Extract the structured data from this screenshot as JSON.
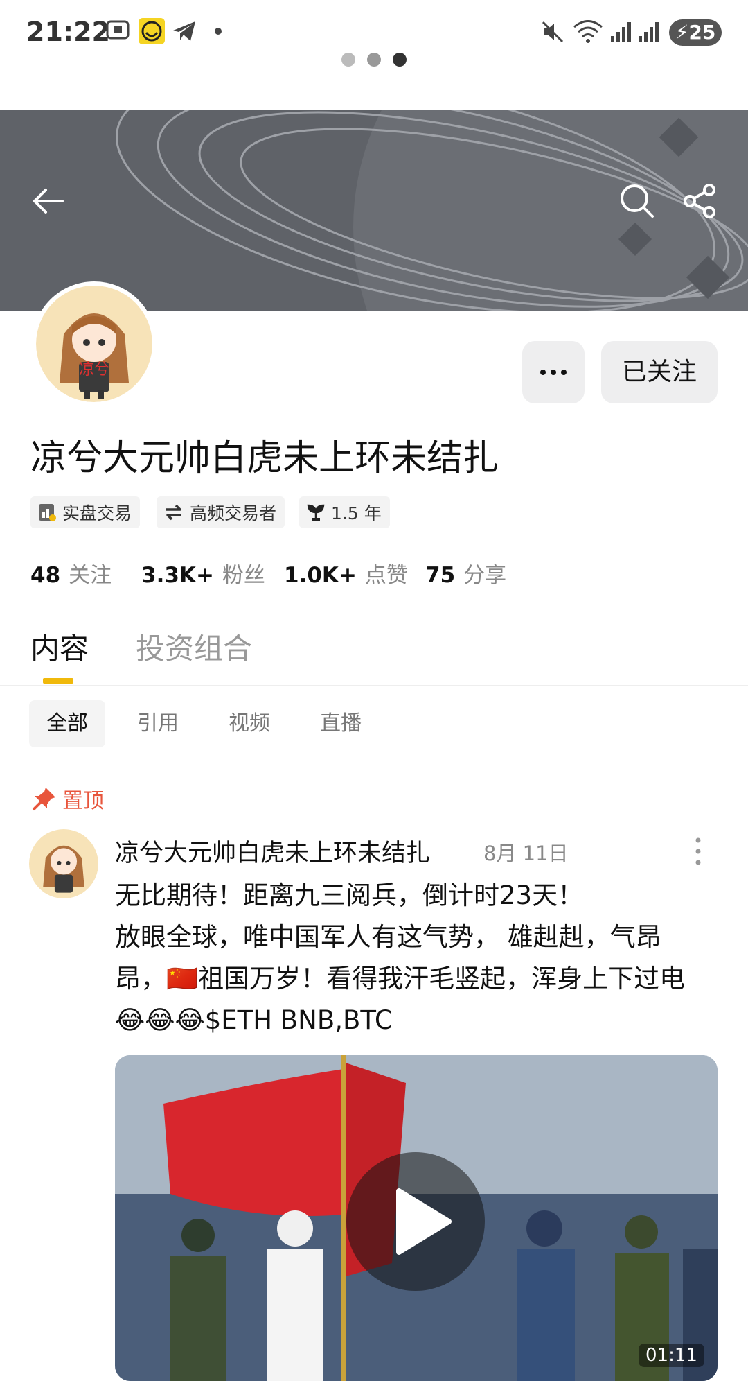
{
  "status_bar": {
    "time": "21:22",
    "battery": "25"
  },
  "header": {
    "back_icon": "arrow-left-icon",
    "search_icon": "search-icon",
    "share_icon": "share-icon"
  },
  "profile": {
    "username": "凉兮大元帅白虎未上环未结扎",
    "avatar_text": "凉兮",
    "more_label": "···",
    "follow_label": "已关注",
    "tags": [
      {
        "label": "实盘交易",
        "icon": "chart-badge-icon"
      },
      {
        "label": "高频交易者",
        "icon": "swap-icon"
      },
      {
        "label": "1.5 年",
        "icon": "sprout-icon"
      }
    ],
    "stats": [
      {
        "value": "48",
        "label": "关注"
      },
      {
        "value": "3.3K+",
        "label": "粉丝"
      },
      {
        "value": "1.0K+",
        "label": "点赞"
      },
      {
        "value": "75",
        "label": "分享"
      }
    ]
  },
  "tabs": [
    {
      "label": "内容",
      "active": true
    },
    {
      "label": "投资组合",
      "active": false
    }
  ],
  "sub_tabs": [
    {
      "label": "全部",
      "active": true
    },
    {
      "label": "引用"
    },
    {
      "label": "视频"
    },
    {
      "label": "直播"
    }
  ],
  "accent_color": "#f0b90b",
  "pinned_label": "置顶",
  "post": {
    "author": "凉兮大元帅白虎未上环未结扎",
    "date": "8月 11日",
    "text_line1": "无比期待！距离九三阅兵，倒计时23天！",
    "text_line2": "放眼全球，唯中国军人有这气势， 雄赳赳，气昂昂，🇨🇳祖国万岁！看得我汗毛竖起，浑身上下过电😂😂😂$ETH BNB,BTC",
    "video_duration": "01:11"
  }
}
